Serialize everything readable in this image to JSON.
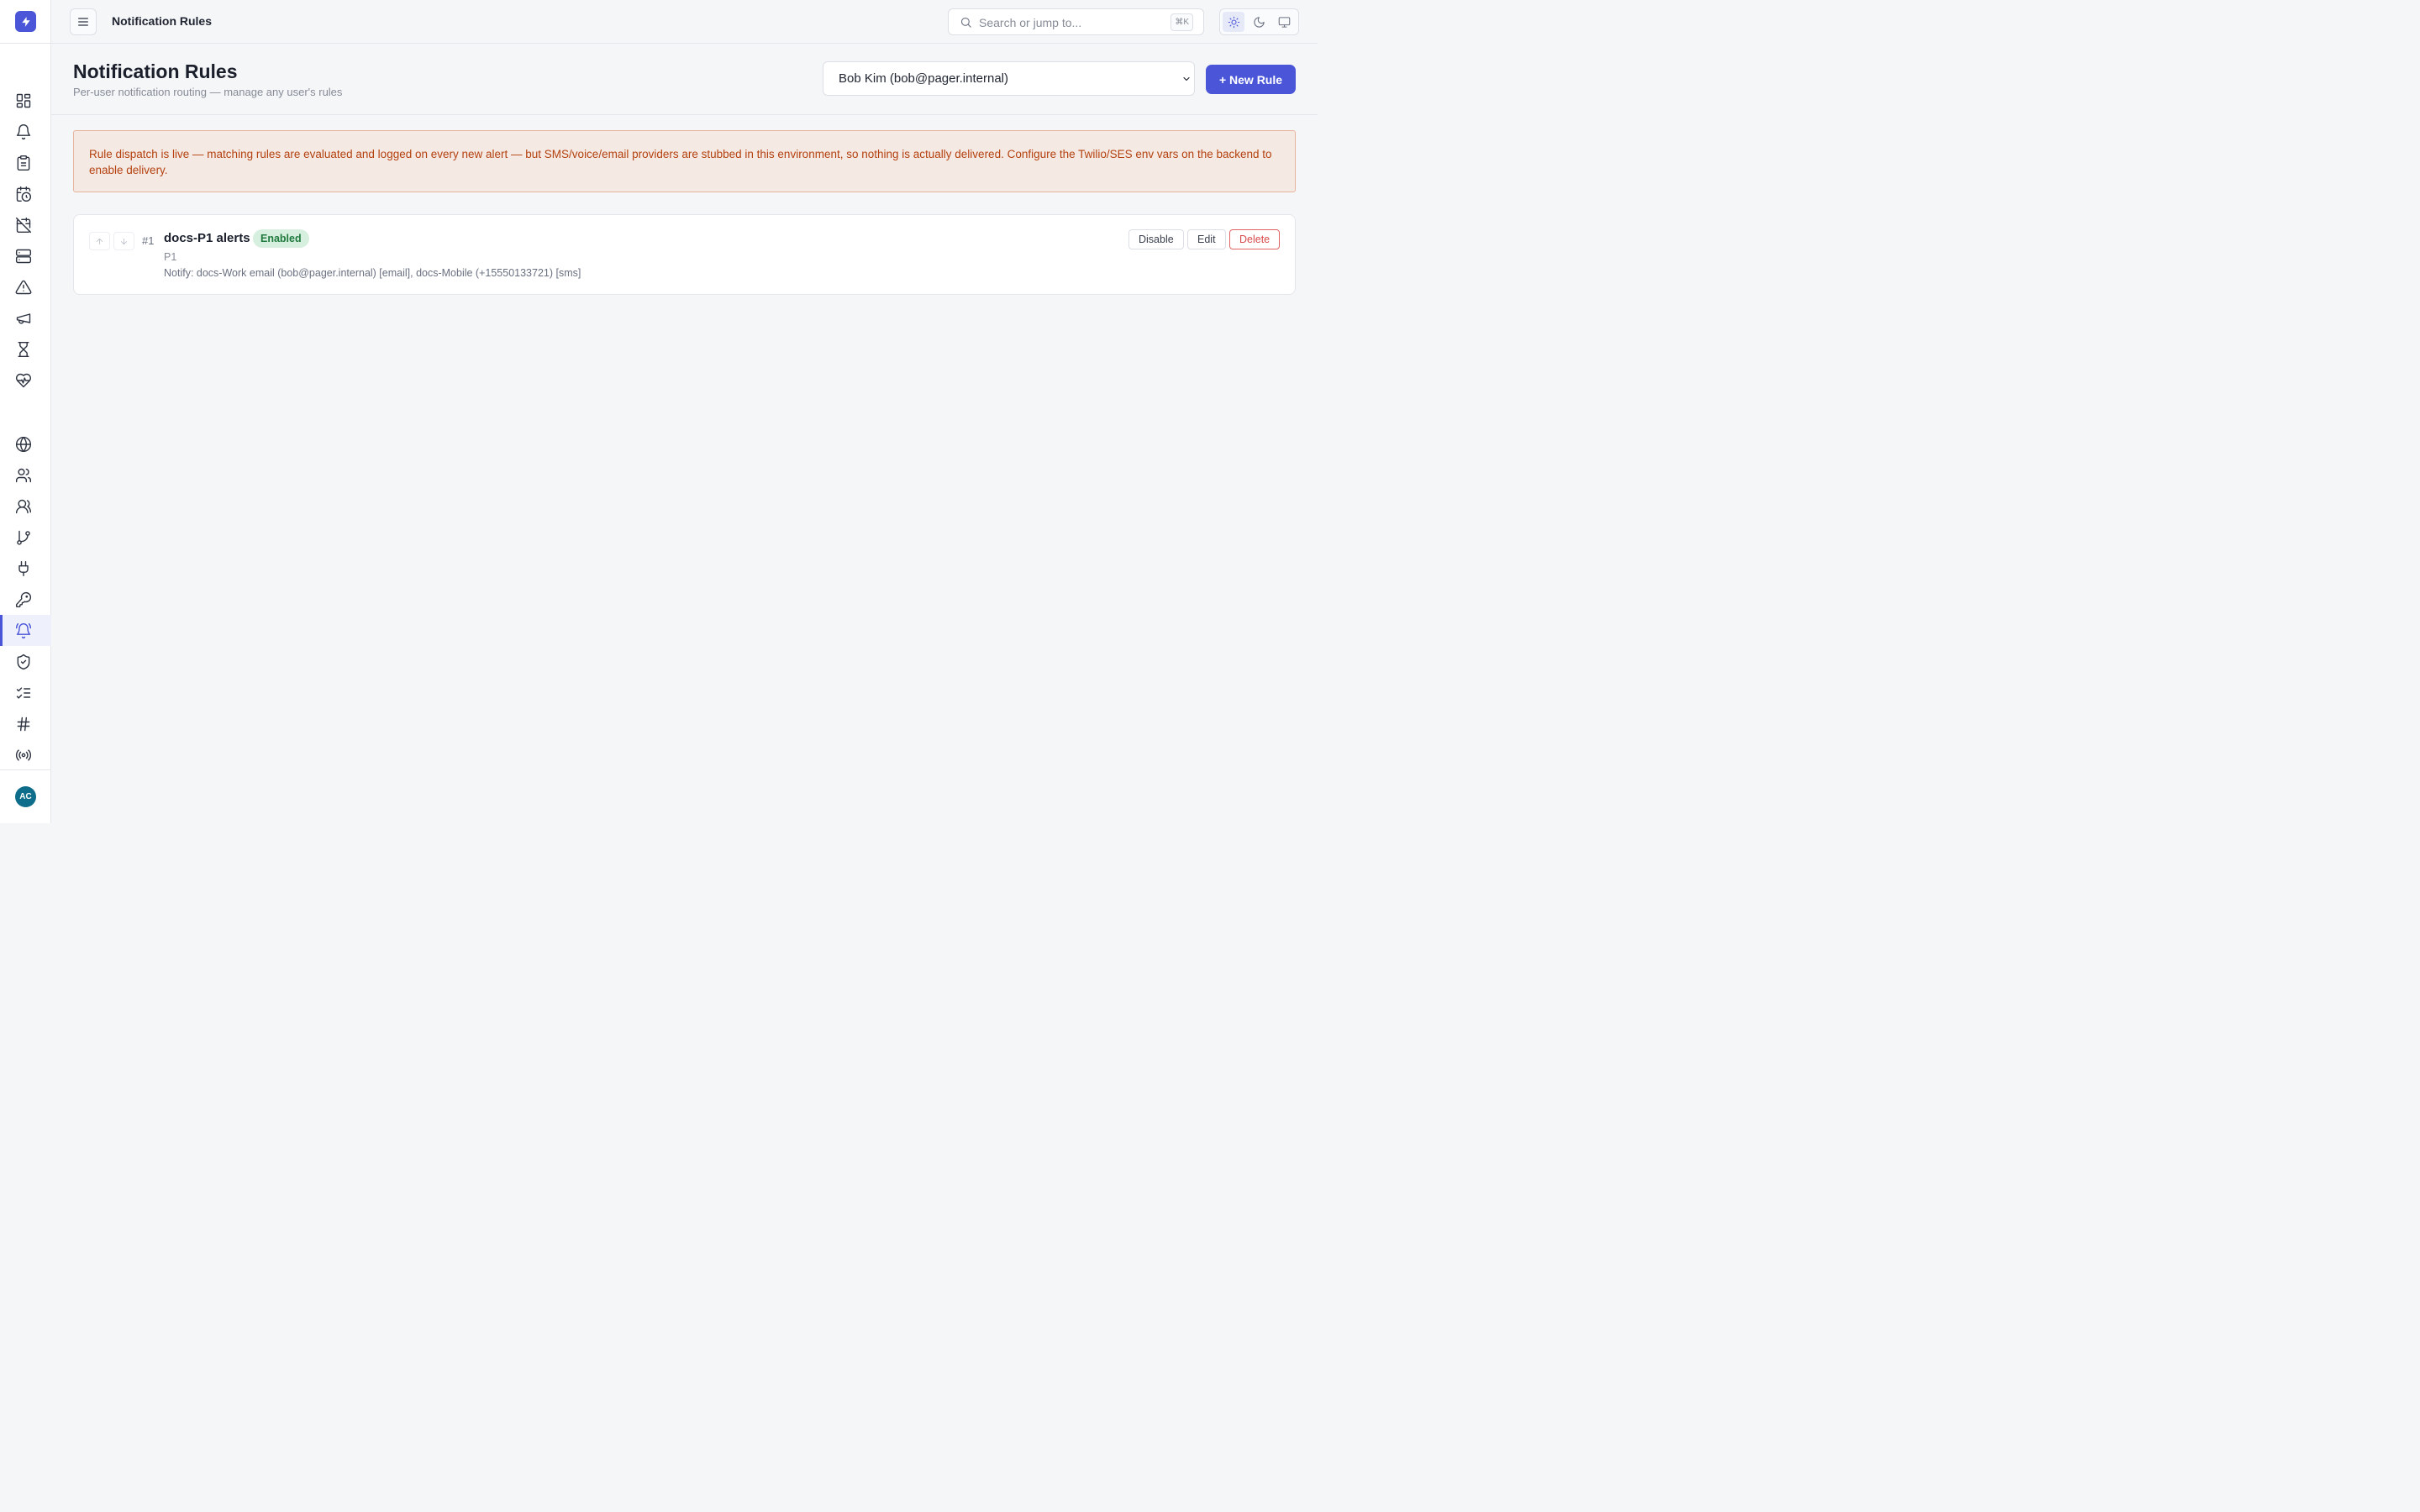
{
  "app": {
    "logo_icon": "lightning-icon",
    "accent_color": "#4a55d8"
  },
  "sidebar": {
    "items": [
      {
        "name": "dashboard",
        "icon": "grid-icon"
      },
      {
        "name": "alerts",
        "icon": "bell-icon"
      },
      {
        "name": "incidents",
        "icon": "clipboard-icon"
      },
      {
        "name": "schedules",
        "icon": "calendar-clock-icon"
      },
      {
        "name": "maintenance",
        "icon": "calendar-off-icon"
      },
      {
        "name": "services",
        "icon": "server-icon"
      },
      {
        "name": "warnings",
        "icon": "warning-triangle-icon"
      },
      {
        "name": "announcements",
        "icon": "megaphone-icon"
      },
      {
        "name": "timers",
        "icon": "hourglass-icon"
      },
      {
        "name": "health",
        "icon": "heart-pulse-icon"
      },
      {
        "name": "status-pages",
        "icon": "globe-icon"
      },
      {
        "name": "teams",
        "icon": "users-icon"
      },
      {
        "name": "users",
        "icon": "users-alt-icon"
      },
      {
        "name": "escalation",
        "icon": "git-branch-icon"
      },
      {
        "name": "integrations",
        "icon": "plug-icon"
      },
      {
        "name": "api-keys",
        "icon": "key-icon"
      },
      {
        "name": "notification-rules",
        "icon": "bell-ring-icon",
        "active": true
      },
      {
        "name": "security",
        "icon": "shield-check-icon"
      },
      {
        "name": "checklists",
        "icon": "list-check-icon"
      },
      {
        "name": "channels",
        "icon": "hash-icon"
      },
      {
        "name": "broadcast",
        "icon": "radio-icon"
      }
    ],
    "avatar_initials": "AC"
  },
  "topbar": {
    "title": "Notification Rules",
    "search_placeholder": "Search or jump to...",
    "search_shortcut": "⌘K",
    "theme_options": [
      "light",
      "dark",
      "system"
    ],
    "theme_selected": "light"
  },
  "header": {
    "title": "Notification Rules",
    "subtitle": "Per-user notification routing — manage any user's rules",
    "user_select_value": "Bob Kim (bob@pager.internal)",
    "new_rule_label": "+ New Rule"
  },
  "banner": {
    "text": "Rule dispatch is live — matching rules are evaluated and logged on every new alert — but SMS/voice/email providers are stubbed in this environment, so nothing is actually delivered. Configure the Twilio/SES env vars on the backend to enable delivery."
  },
  "rules": [
    {
      "index": "#1",
      "name": "docs-P1 alerts",
      "status": "Enabled",
      "priority": "P1",
      "notify": "Notify: docs-Work email (bob@pager.internal) [email], docs-Mobile (+15550133721) [sms]",
      "actions": {
        "disable": "Disable",
        "edit": "Edit",
        "delete": "Delete"
      }
    }
  ]
}
